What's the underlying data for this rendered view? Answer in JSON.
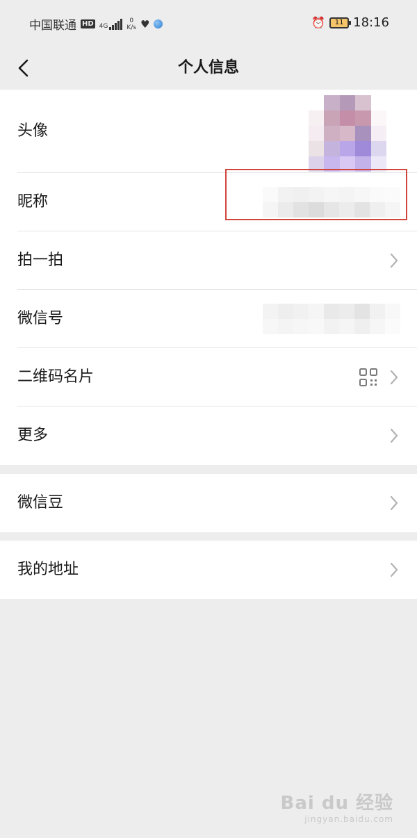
{
  "status_bar": {
    "carrier": "中国联通",
    "hd_badge": "HD",
    "network": "4G",
    "speed_value": "0",
    "speed_unit": "K/s",
    "battery": "11",
    "time": "18:16",
    "icons": [
      "signal-bars-icon",
      "heart-icon",
      "globe-icon",
      "alarm-icon",
      "battery-icon"
    ]
  },
  "navbar": {
    "title": "个人信息",
    "back_icon": "chevron-left-icon"
  },
  "profile": {
    "avatar_label": "头像",
    "nickname_label": "昵称",
    "pat_label": "拍一拍",
    "wechat_id_label": "微信号",
    "qr_card_label": "二维码名片",
    "more_label": "更多"
  },
  "beans": {
    "label": "微信豆"
  },
  "address": {
    "label": "我的地址"
  },
  "watermark": {
    "main": "Bai du 经验",
    "sub": "jingyan.baidu.com"
  },
  "colors": {
    "background": "#ededed",
    "card": "#ffffff",
    "highlight_box": "#d0463d"
  }
}
